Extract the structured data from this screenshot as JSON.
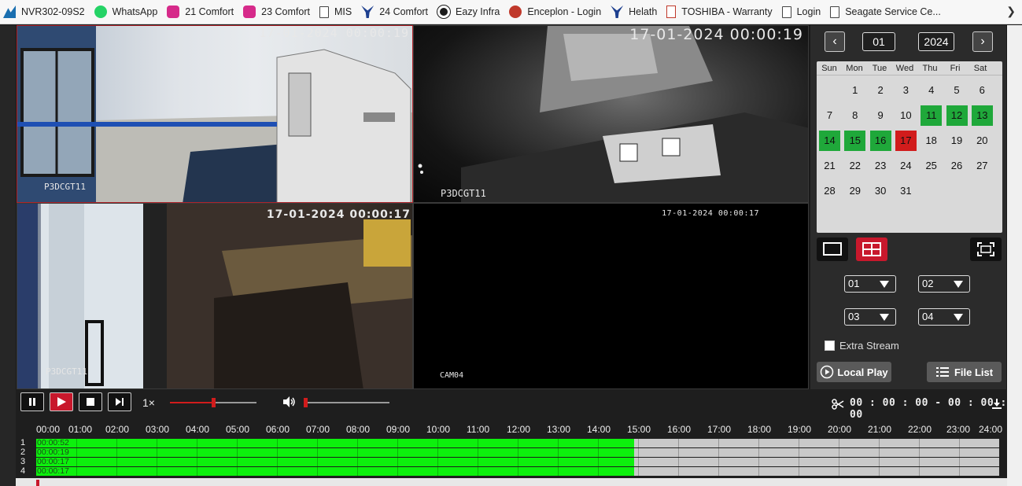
{
  "bookmarks": [
    {
      "label": "NVR302-09S2",
      "icon": "nvr-icon"
    },
    {
      "label": "WhatsApp",
      "icon": "whatsapp-icon"
    },
    {
      "label": "21 Comfort",
      "icon": "comfort-icon"
    },
    {
      "label": "23 Comfort",
      "icon": "comfort-icon"
    },
    {
      "label": "MIS",
      "icon": "document-icon"
    },
    {
      "label": "24 Comfort",
      "icon": "bird-icon"
    },
    {
      "label": "Eazy Infra",
      "icon": "circle-icon"
    },
    {
      "label": "Enceplon - Login",
      "icon": "enceplon-icon"
    },
    {
      "label": "Helath",
      "icon": "bird-icon"
    },
    {
      "label": "TOSHIBA - Warranty",
      "icon": "pdf-icon"
    },
    {
      "label": "Login",
      "icon": "document-icon"
    },
    {
      "label": "Seagate Service Ce...",
      "icon": "document-icon"
    }
  ],
  "cameras": [
    {
      "timestamp": "17-01-2024 00:00:19",
      "name": "P3DCGT11"
    },
    {
      "timestamp": "17-01-2024 00:00:19",
      "name": "P3DCGT11"
    },
    {
      "timestamp": "17-01-2024 00:00:17",
      "name": "P3DCGT11"
    },
    {
      "timestamp": "17-01-2024 00:00:17",
      "name": "CAM04"
    }
  ],
  "calendar": {
    "month": "01",
    "year": "2024",
    "prev": "‹",
    "next": "›",
    "days_of_week": [
      "Sun",
      "Mon",
      "Tue",
      "Wed",
      "Thu",
      "Fri",
      "Sat"
    ],
    "first_weekday": 1,
    "num_days": 31,
    "record_days": [
      11,
      12,
      13,
      14,
      15,
      16
    ],
    "current_day": 17,
    "record_color": "#1fa83a",
    "current_color": "#d11c1c"
  },
  "channel_selects": [
    "01",
    "02",
    "03",
    "04"
  ],
  "extra_stream_label": "Extra Stream",
  "local_play_label": "Local Play",
  "file_list_label": "File List",
  "playback": {
    "speed": "1×",
    "progress_fraction": 0.5,
    "volume_fraction": 0.0,
    "timecode": "00 : 00 : 00 - 00 : 00 : 00"
  },
  "timeline": {
    "hours": [
      "00:00",
      "01:00",
      "02:00",
      "03:00",
      "04:00",
      "05:00",
      "06:00",
      "07:00",
      "08:00",
      "09:00",
      "10:00",
      "11:00",
      "12:00",
      "13:00",
      "14:00",
      "15:00",
      "16:00",
      "17:00",
      "18:00",
      "19:00",
      "20:00",
      "21:00",
      "22:00",
      "23:00",
      "24:00"
    ],
    "channels": [
      {
        "label": "1",
        "duration": "00:00:52",
        "recorded_until_hour": 14.9
      },
      {
        "label": "2",
        "duration": "00:00:19",
        "recorded_until_hour": 14.9
      },
      {
        "label": "3",
        "duration": "00:00:17",
        "recorded_until_hour": 14.9
      },
      {
        "label": "4",
        "duration": "00:00:17",
        "recorded_until_hour": 14.9
      }
    ],
    "record_color": "#0df00d"
  },
  "accent_color": "#c8182c"
}
